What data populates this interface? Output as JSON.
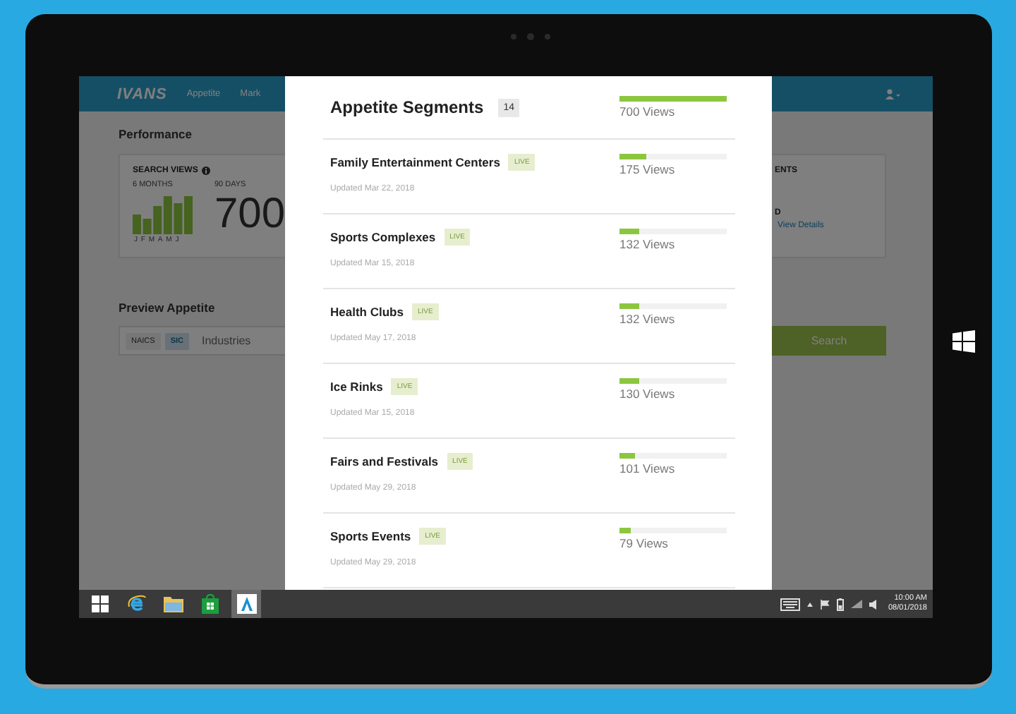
{
  "app": {
    "logo": "IVANS",
    "nav": [
      {
        "label": "Appetite"
      },
      {
        "label": "Mark"
      }
    ],
    "performance_title": "Performance",
    "search_views": {
      "title": "SEARCH VIEWS",
      "period_1": "6 MONTHS",
      "period_2": "90 DAYS",
      "months": [
        "J",
        "F",
        "M",
        "A",
        "M",
        "J"
      ],
      "total": "700"
    },
    "segments_card": {
      "title": "ENTS",
      "line": "D",
      "link": "View Details"
    },
    "preview": {
      "title": "Preview Appetite",
      "toggles": [
        {
          "label": "NAICS",
          "selected": false
        },
        {
          "label": "SIC",
          "selected": true
        }
      ],
      "placeholder": "Industries",
      "button": "Search"
    }
  },
  "modal": {
    "title": "Appetite Segments",
    "count": "14",
    "total": {
      "level": 1,
      "views": "700 Views"
    },
    "segments": [
      {
        "name": "Family Entertainment Centers",
        "badge": "LIVE",
        "updated": "Updated Mar 22, 2018",
        "level": 0.25,
        "views": "175 Views"
      },
      {
        "name": "Sports Complexes",
        "badge": "LIVE",
        "updated": "Updated Mar 15, 2018",
        "level": 0.19,
        "views": "132 Views"
      },
      {
        "name": "Health Clubs",
        "badge": "LIVE",
        "updated": "Updated May 17, 2018",
        "level": 0.19,
        "views": "132 Views"
      },
      {
        "name": "Ice Rinks",
        "badge": "LIVE",
        "updated": "Updated Mar 15, 2018",
        "level": 0.19,
        "views": "130 Views"
      },
      {
        "name": "Fairs and Festivals",
        "badge": "LIVE",
        "updated": "Updated May 29, 2018",
        "level": 0.14,
        "views": "101 Views"
      },
      {
        "name": "Sports Events",
        "badge": "LIVE",
        "updated": "Updated May 29, 2018",
        "level": 0.11,
        "views": "79 Views"
      }
    ]
  },
  "taskbar": {
    "apps": [
      {
        "kind": "start",
        "active": false
      },
      {
        "kind": "browser",
        "active": false
      },
      {
        "kind": "files",
        "active": false
      },
      {
        "kind": "store",
        "active": false
      },
      {
        "kind": "app",
        "active": true
      }
    ],
    "time": "10:00 AM",
    "date": "08/01/2018"
  }
}
